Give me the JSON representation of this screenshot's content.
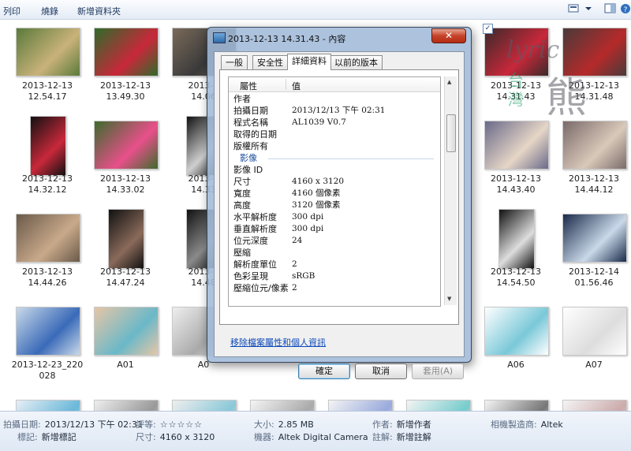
{
  "toolbar": {
    "print": "列印",
    "burn": "燒錄",
    "new_folder": "新增資料夾"
  },
  "tiles": [
    {
      "col": 0,
      "row": 0,
      "l1": "2013-12-13",
      "l2": "12.54.17",
      "c1": "#5a7a3a",
      "c2": "#c9b27a"
    },
    {
      "col": 1,
      "row": 0,
      "l1": "2013-12-13",
      "l2": "13.49.30",
      "c1": "#2f6b2a",
      "c2": "#c8283a"
    },
    {
      "col": 2,
      "row": 0,
      "l1": "2013-1",
      "l2": "14.06",
      "c1": "#7a6a5a",
      "c2": "#3a3a3a"
    },
    {
      "col": 6,
      "row": 0,
      "l1": "2013-12-13",
      "l2": "14.31.43",
      "c1": "#3a2a2a",
      "c2": "#c8283a"
    },
    {
      "col": 7,
      "row": 0,
      "l1": "2013-12-13",
      "l2": "14.31.48",
      "c1": "#4a3a3a",
      "c2": "#b52a2a"
    },
    {
      "col": 0,
      "row": 1,
      "l1": "2013-12-13",
      "l2": "14.32.12",
      "c1": "#111",
      "c2": "#c8283a",
      "tall": true
    },
    {
      "col": 1,
      "row": 1,
      "l1": "2013-12-13",
      "l2": "14.33.02",
      "c1": "#3d6b2d",
      "c2": "#e8508a"
    },
    {
      "col": 2,
      "row": 1,
      "l1": "2013-1",
      "l2": "14.33",
      "c1": "#111",
      "c2": "#cfcfcf",
      "tall": true
    },
    {
      "col": 6,
      "row": 1,
      "l1": "2013-12-13",
      "l2": "14.43.40",
      "c1": "#6a6a8a",
      "c2": "#e6d6c6"
    },
    {
      "col": 7,
      "row": 1,
      "l1": "2013-12-13",
      "l2": "14.44.12",
      "c1": "#7a6a6a",
      "c2": "#d9c9b9"
    },
    {
      "col": 0,
      "row": 2,
      "l1": "2013-12-13",
      "l2": "14.44.26",
      "c1": "#6a5a4a",
      "c2": "#c9a98a"
    },
    {
      "col": 1,
      "row": 2,
      "l1": "2013-12-13",
      "l2": "14.47.24",
      "c1": "#111",
      "c2": "#8a6a5a",
      "tall": true
    },
    {
      "col": 2,
      "row": 2,
      "l1": "2013-1",
      "l2": "14.48",
      "c1": "#111",
      "c2": "#8a8a8a",
      "tall": true
    },
    {
      "col": 6,
      "row": 2,
      "l1": "2013-12-13",
      "l2": "14.54.50",
      "c1": "#111",
      "c2": "#ddd",
      "tall": true
    },
    {
      "col": 7,
      "row": 2,
      "l1": "2013-12-14",
      "l2": "01.56.46",
      "c1": "#1a2a4a",
      "c2": "#c9d9e9"
    },
    {
      "col": 0,
      "row": 3,
      "l1": "2013-12-23_220",
      "l2": "028",
      "c1": "#c9d9e9",
      "c2": "#3a6ab8"
    },
    {
      "col": 1,
      "row": 3,
      "l1": "A01",
      "l2": "",
      "c1": "#e6c6a6",
      "c2": "#6ab8c8"
    },
    {
      "col": 2,
      "row": 3,
      "l1": "A0",
      "l2": "",
      "c1": "#eee",
      "c2": "#aaa"
    },
    {
      "col": 6,
      "row": 3,
      "l1": "A06",
      "l2": "",
      "c1": "#fff",
      "c2": "#7ac8d8"
    },
    {
      "col": 7,
      "row": 3,
      "l1": "A07",
      "l2": "",
      "c1": "#fff",
      "c2": "#ddd"
    },
    {
      "col": 0,
      "row": 4,
      "l1": "",
      "l2": "",
      "c1": "#e6eef6",
      "c2": "#6ab8d8"
    },
    {
      "col": 1,
      "row": 4,
      "l1": "",
      "l2": "",
      "c1": "#eee",
      "c2": "#999"
    },
    {
      "col": 2,
      "row": 4,
      "l1": "",
      "l2": "",
      "c1": "#eee",
      "c2": "#8ac8d8"
    },
    {
      "col": 3,
      "row": 4,
      "l1": "",
      "l2": "",
      "c1": "#f4f4f4",
      "c2": "#aaa"
    },
    {
      "col": 4,
      "row": 4,
      "l1": "",
      "l2": "",
      "c1": "#f4f4f4",
      "c2": "#9ad"
    },
    {
      "col": 5,
      "row": 4,
      "l1": "",
      "l2": "",
      "c1": "#f4f4f4",
      "c2": "#7cc"
    },
    {
      "col": 6,
      "row": 4,
      "l1": "",
      "l2": "",
      "c1": "#f4f4f4",
      "c2": "#777"
    },
    {
      "col": 7,
      "row": 4,
      "l1": "",
      "l2": "",
      "c1": "#f4f4f4",
      "c2": "#caa"
    }
  ],
  "watermark": {
    "script": "lyric",
    "cjk1": "台",
    "cjk2": "灣",
    "cjk3": "熊"
  },
  "dialog": {
    "title": "2013-12-13 14.31.43 - 內容",
    "close": "✕",
    "tabs": [
      "一般",
      "安全性",
      "詳細資料",
      "以前的版本"
    ],
    "active_tab": 2,
    "col_property": "屬性",
    "col_value": "值",
    "rows": [
      {
        "k": "作者",
        "v": ""
      },
      {
        "k": "拍攝日期",
        "v": "2013/12/13 下午 02:31"
      },
      {
        "k": "程式名稱",
        "v": "AL1039    V0.7"
      },
      {
        "k": "取得的日期",
        "v": ""
      },
      {
        "k": "版權所有",
        "v": ""
      },
      {
        "group": "影像"
      },
      {
        "k": "影像 ID",
        "v": ""
      },
      {
        "k": "尺寸",
        "v": "4160 x 3120"
      },
      {
        "k": "寬度",
        "v": "4160 個像素"
      },
      {
        "k": "高度",
        "v": "3120 個像素"
      },
      {
        "k": "水平解析度",
        "v": "300 dpi"
      },
      {
        "k": "垂直解析度",
        "v": "300 dpi"
      },
      {
        "k": "位元深度",
        "v": "24"
      },
      {
        "k": "壓縮",
        "v": ""
      },
      {
        "k": "解析度單位",
        "v": "2"
      },
      {
        "k": "色彩呈現",
        "v": "sRGB"
      },
      {
        "k": "壓縮位元/像素",
        "v": "2"
      }
    ],
    "remove_link": "移除檔案屬性和個人資訊",
    "ok": "確定",
    "cancel": "取消",
    "apply": "套用(A)"
  },
  "status": {
    "date_taken_label": "拍攝日期:",
    "date_taken": "2013/12/13 下午 02:31",
    "tags_label": "標記:",
    "tags": "新增標記",
    "rating_label": "評等:",
    "stars": "☆☆☆☆☆",
    "dimensions_label": "尺寸:",
    "dimensions": "4160 x 3120",
    "size_label": "大小:",
    "size": "2.85 MB",
    "model_label": "機器:",
    "model": "Altek Digital Camera",
    "author_label": "作者:",
    "author": "新增作者",
    "comments_label": "註解:",
    "comments": "新增註解",
    "maker_label": "相機製造商:",
    "maker": "Altek"
  }
}
